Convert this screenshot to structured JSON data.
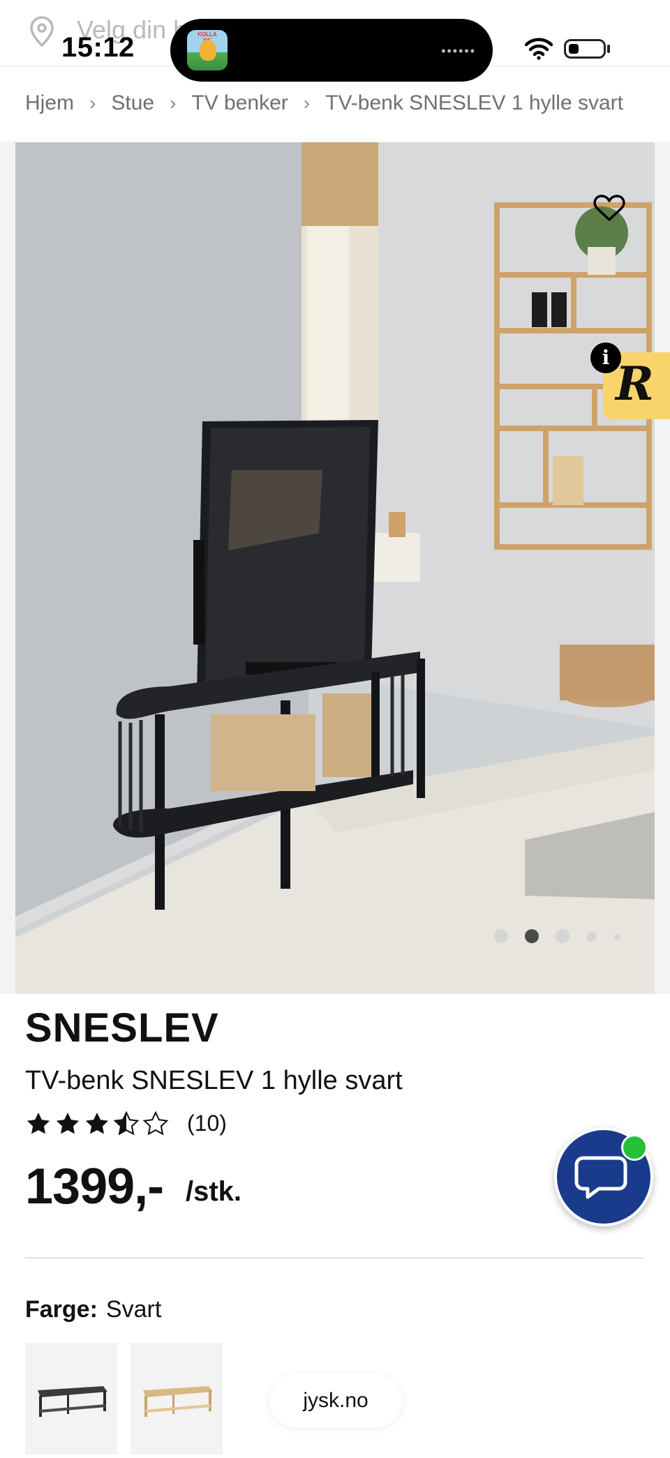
{
  "status_bar": {
    "time": "15:12"
  },
  "location": {
    "placeholder": "Velg din b"
  },
  "breadcrumb": {
    "items": [
      "Hjem",
      "Stue",
      "TV benker",
      "TV-benk SNESLEV 1 hylle svart"
    ],
    "separator": "›"
  },
  "gallery": {
    "image_count": 5,
    "active_index": 1
  },
  "product": {
    "brand": "SNESLEV",
    "name": "TV-benk SNESLEV 1 hylle svart",
    "rating": 4.5,
    "rating_max": 5,
    "review_count": "(10)",
    "price": "1399,-",
    "unit": "/stk."
  },
  "options": {
    "color_label": "Farge:",
    "color_value": "Svart",
    "swatches": [
      "black",
      "natural-wood"
    ]
  },
  "footer": {
    "domain": "jysk.no"
  },
  "colors": {
    "chat_button": "#1a3b8c",
    "online_indicator": "#26c038",
    "badge_yellow": "#f8d46a"
  }
}
